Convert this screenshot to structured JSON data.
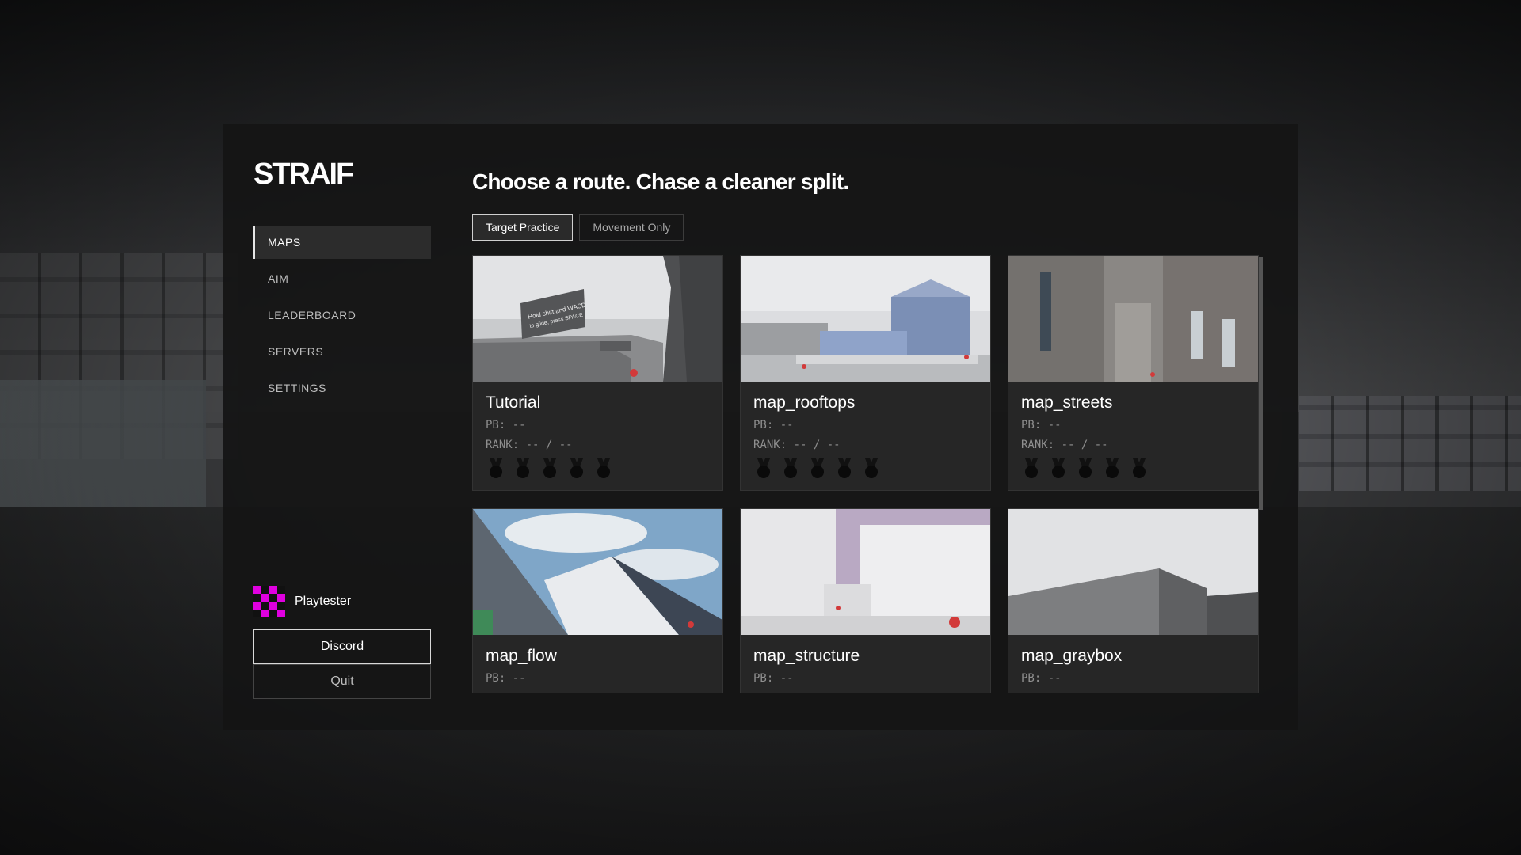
{
  "app": {
    "brand": "STRAIF"
  },
  "nav": {
    "items": [
      "MAPS",
      "AIM",
      "LEADERBOARD",
      "SERVERS",
      "SETTINGS"
    ],
    "active": "MAPS"
  },
  "main": {
    "headline": "Choose a route. Chase a cleaner split.",
    "tabs": [
      {
        "label": "Target Practice",
        "active": true
      },
      {
        "label": "Movement Only",
        "active": false
      }
    ]
  },
  "maps": [
    {
      "name": "Tutorial",
      "pb": "PB: --",
      "rank": "RANK: -- / --",
      "medals": 5
    },
    {
      "name": "map_rooftops",
      "pb": "PB: --",
      "rank": "RANK: -- / --",
      "medals": 5
    },
    {
      "name": "map_streets",
      "pb": "PB: --",
      "rank": "RANK: -- / --",
      "medals": 5
    },
    {
      "name": "map_flow",
      "pb": "PB: --"
    },
    {
      "name": "map_structure",
      "pb": "PB: --"
    },
    {
      "name": "map_graybox",
      "pb": "PB: --"
    }
  ],
  "tutorial_sign": {
    "line1": "Hold shift and WASD",
    "line2": "to glide, press SPACE"
  },
  "profile": {
    "name": "Playtester",
    "avatar_color": "#e000e0"
  },
  "actions": {
    "discord": "Discord",
    "quit": "Quit"
  }
}
